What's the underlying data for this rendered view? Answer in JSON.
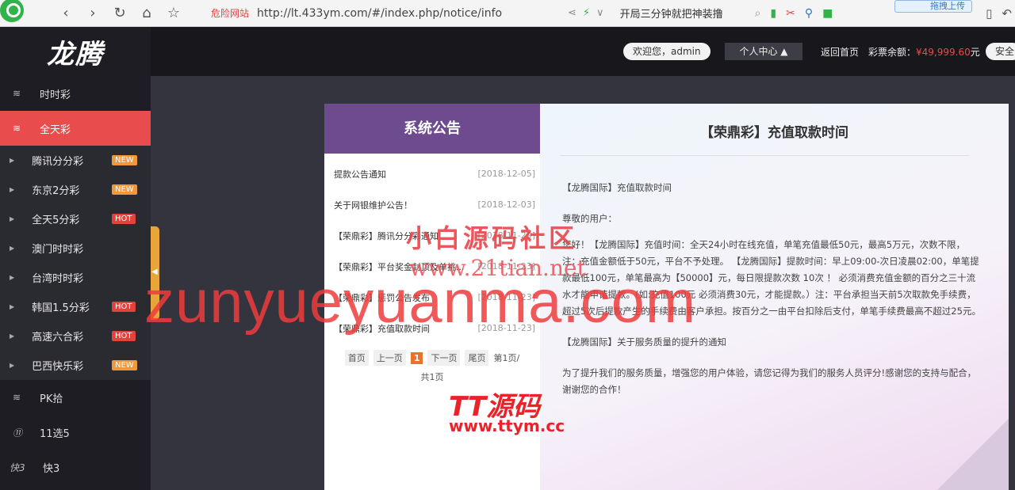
{
  "browser": {
    "danger_label": "危险网站",
    "url": "http://lt.433ym.com/#/index.php/notice/info",
    "search_text": "开局三分钟就把神装撸",
    "drag_upload": "拖拽上传"
  },
  "brand": {
    "logo_text": "龙腾"
  },
  "sidebar": {
    "main_items": [
      {
        "label": "时时彩",
        "icon": "ssc-icon"
      },
      {
        "label": "全天彩",
        "icon": "qtc-icon"
      }
    ],
    "sub_items": [
      {
        "label": "腾讯分分彩",
        "badge": "NEW"
      },
      {
        "label": "东京2分彩",
        "badge": "NEW"
      },
      {
        "label": "全天5分彩",
        "badge": "HOT"
      },
      {
        "label": "澳门时时彩",
        "badge": ""
      },
      {
        "label": "台湾时时彩",
        "badge": ""
      },
      {
        "label": "韩国1.5分彩",
        "badge": "HOT"
      },
      {
        "label": "高速六合彩",
        "badge": "HOT"
      },
      {
        "label": "巴西快乐彩",
        "badge": "NEW"
      }
    ],
    "bottom_items": [
      {
        "label": "PK拾"
      },
      {
        "label": "11选5"
      },
      {
        "label": "快3",
        "icon_text": "快3"
      }
    ]
  },
  "header": {
    "welcome": "欢迎您，admin",
    "personal_center": "个人中心 ▲",
    "home": "返回首页",
    "balance_label": "彩票余额：",
    "balance_amount": "¥49,999.60",
    "balance_unit": "元",
    "secure": "安全"
  },
  "notices": {
    "title": "系统公告",
    "items": [
      {
        "title": "提款公告通知",
        "date": "[2018-12-05]"
      },
      {
        "title": "关于网银维护公告！",
        "date": "[2018-12-03]"
      },
      {
        "title": "【荣鼎彩】腾讯分分彩通知",
        "date": "[2018-11-29]"
      },
      {
        "title": "【荣鼎彩】平台奖金封顶及单挑...",
        "date": "[2018-11-23]"
      },
      {
        "title": "【荣鼎彩】惩罚公告发布",
        "date": "[2018-11-23]"
      },
      {
        "title": "【荣鼎彩】充值取款时间",
        "date": "[2018-11-23]"
      }
    ],
    "pager": {
      "first": "首页",
      "prev": "上一页",
      "current": "1",
      "next": "下一页",
      "last": "尾页",
      "page_info": "第1页/",
      "total": "共1页"
    }
  },
  "article": {
    "title": "【荣鼎彩】充值取款时间",
    "p1": "【龙腾国际】充值取款时间",
    "p2": "尊敬的用户：",
    "p3": "您好！【龙腾国际】充值时间：全天24小时在线充值，单笔充值最低50元，最高5万元，次数不限，注：充值金额低于50元，平台不予处理。 【龙腾国际】提款时间：早上09:00-次日凌晨02:00，单笔提款最低100元，单笔最高为【50000】元，每日限提款次数 10次 ！ 必须消费充值金额的百分之三十流水才能申请提款。(如:充值100元 必须消费30元，才能提款。）注：平台承担当天前5次取款免手续费，超过5次后提款产生的手续费由客户承担。按百分之一由平台扣除后支付，单笔手续费最高不超过25元。",
    "p4": "【龙腾国际】关于服务质量的提升的通知",
    "p5": "为了提升我们的服务质量，增强您的用户体验，请您记得为我们的服务人员评分!感谢您的支持与配合，谢谢您的合作！"
  },
  "watermarks": {
    "w1": "小白源码社区",
    "w2": "www.21tian.net",
    "w3": "zunyueyuanma.com",
    "w4": "TT源码",
    "w5": "www.ttym.cc"
  }
}
